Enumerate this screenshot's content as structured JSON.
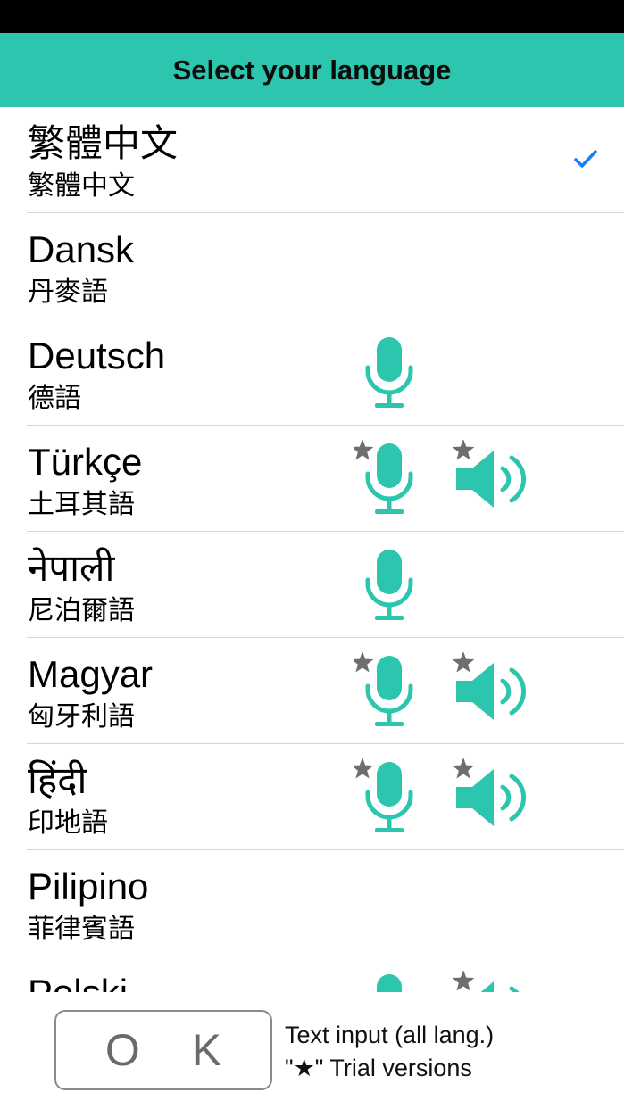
{
  "header": {
    "title": "Select your language"
  },
  "languages": [
    {
      "name": "繁體中文",
      "sub": "繁體中文",
      "selected": true,
      "mic": false,
      "mic_trial": false,
      "speaker": false,
      "speaker_trial": false
    },
    {
      "name": "Dansk",
      "sub": "丹麥語",
      "selected": false,
      "mic": false,
      "mic_trial": false,
      "speaker": false,
      "speaker_trial": false
    },
    {
      "name": "Deutsch",
      "sub": "德語",
      "selected": false,
      "mic": true,
      "mic_trial": false,
      "speaker": false,
      "speaker_trial": false
    },
    {
      "name": "Türkçe",
      "sub": "土耳其語",
      "selected": false,
      "mic": true,
      "mic_trial": true,
      "speaker": true,
      "speaker_trial": true
    },
    {
      "name": "नेपाली",
      "sub": "尼泊爾語",
      "selected": false,
      "mic": true,
      "mic_trial": false,
      "speaker": false,
      "speaker_trial": false
    },
    {
      "name": "Magyar",
      "sub": "匈牙利語",
      "selected": false,
      "mic": true,
      "mic_trial": true,
      "speaker": true,
      "speaker_trial": true
    },
    {
      "name": "हिंदी",
      "sub": "印地語",
      "selected": false,
      "mic": true,
      "mic_trial": true,
      "speaker": true,
      "speaker_trial": true
    },
    {
      "name": "Pilipino",
      "sub": "菲律賓語",
      "selected": false,
      "mic": false,
      "mic_trial": false,
      "speaker": false,
      "speaker_trial": false
    },
    {
      "name": "Polski",
      "sub": "",
      "selected": false,
      "mic": true,
      "mic_trial": false,
      "speaker": true,
      "speaker_trial": true
    }
  ],
  "footer": {
    "ok_label": "O K",
    "note_line1": "Text input (all lang.)",
    "note_line2": "\"★\" Trial versions"
  },
  "colors": {
    "accent": "#2bc6ad",
    "check": "#1a7cf5",
    "star": "#6e6e6e"
  },
  "icons": {
    "mic": "microphone-icon",
    "speaker": "speaker-icon",
    "star": "star-icon",
    "check": "checkmark-icon"
  }
}
